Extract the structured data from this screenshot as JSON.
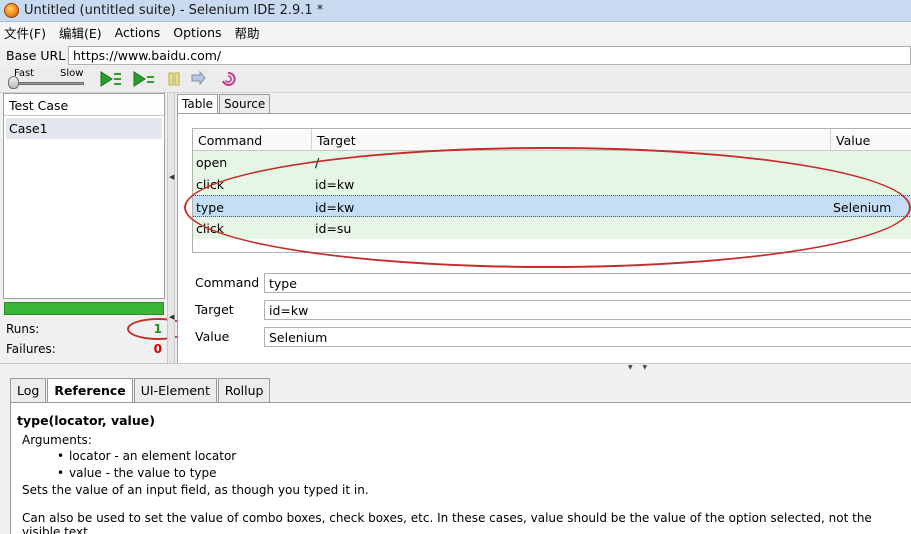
{
  "window": {
    "title": "Untitled (untitled suite) - Selenium IDE 2.9.1 *"
  },
  "menu": {
    "items": [
      "文件(F)",
      "编辑(E)",
      "Actions",
      "Options",
      "帮助"
    ]
  },
  "base_url": {
    "label": "Base URL",
    "value": "https://www.baidu.com/"
  },
  "toolbar": {
    "speed_fast": "Fast",
    "speed_slow": "Slow",
    "speed_level": 0,
    "icons": [
      "play-all-icon",
      "play-current-icon",
      "pause-icon",
      "step-icon",
      "rollup-icon"
    ]
  },
  "test_case_panel": {
    "header": "Test Case",
    "items": [
      "Case1"
    ]
  },
  "run_stats": {
    "progress": 1.0,
    "runs_label": "Runs:",
    "runs": "1",
    "failures_label": "Failures:",
    "failures": "0"
  },
  "editor_tabs": [
    "Table",
    "Source"
  ],
  "command_table": {
    "columns": [
      "Command",
      "Target",
      "Value"
    ],
    "rows": [
      {
        "command": "open",
        "target": "/",
        "value": ""
      },
      {
        "command": "click",
        "target": "id=kw",
        "value": ""
      },
      {
        "command": "type",
        "target": "id=kw",
        "value": "Selenium"
      },
      {
        "command": "click",
        "target": "id=su",
        "value": ""
      }
    ]
  },
  "command_form": {
    "command_label": "Command",
    "command_value": "type",
    "target_label": "Target",
    "target_value": "id=kw",
    "value_label": "Value",
    "value_value": "Selenium"
  },
  "bottom_tabs": [
    "Log",
    "Reference",
    "UI-Element",
    "Rollup"
  ],
  "reference": {
    "signature": "type(locator, value)",
    "arguments_label": "Arguments:",
    "arguments": [
      "locator - an element locator",
      "value - the value to type"
    ],
    "description": "Sets the value of an input field, as though you typed it in.",
    "note": "Can also be used to set the value of combo boxes, check boxes, etc. In these cases, value should be the value of the option selected, not the visible text."
  },
  "colors": {
    "progress": "#38b638",
    "runs": "#1f8f1f",
    "failures": "#cc0000",
    "annotation": "#c62a2a",
    "selected_row": "#c4dff5",
    "row": "#e5f6e5"
  }
}
